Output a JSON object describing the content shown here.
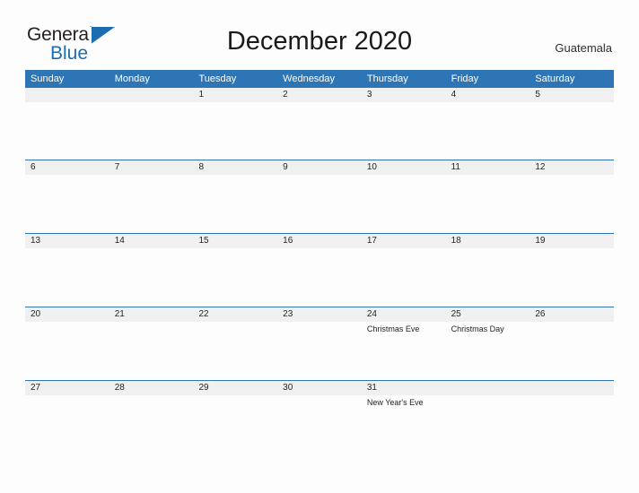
{
  "logo": {
    "primary_text": "General",
    "secondary_text": "Blue",
    "triangle_icon": "triangle-icon",
    "brand_color": "#1b6cb0"
  },
  "header": {
    "title": "December 2020",
    "country": "Guatemala"
  },
  "calendar": {
    "header_color": "#2e75b6",
    "date_band_color": "#f0f0f0",
    "weekdays": [
      "Sunday",
      "Monday",
      "Tuesday",
      "Wednesday",
      "Thursday",
      "Friday",
      "Saturday"
    ],
    "weeks": [
      {
        "days": [
          {
            "date": "",
            "event": ""
          },
          {
            "date": "",
            "event": ""
          },
          {
            "date": "1",
            "event": ""
          },
          {
            "date": "2",
            "event": ""
          },
          {
            "date": "3",
            "event": ""
          },
          {
            "date": "4",
            "event": ""
          },
          {
            "date": "5",
            "event": ""
          }
        ]
      },
      {
        "days": [
          {
            "date": "6",
            "event": ""
          },
          {
            "date": "7",
            "event": ""
          },
          {
            "date": "8",
            "event": ""
          },
          {
            "date": "9",
            "event": ""
          },
          {
            "date": "10",
            "event": ""
          },
          {
            "date": "11",
            "event": ""
          },
          {
            "date": "12",
            "event": ""
          }
        ]
      },
      {
        "days": [
          {
            "date": "13",
            "event": ""
          },
          {
            "date": "14",
            "event": ""
          },
          {
            "date": "15",
            "event": ""
          },
          {
            "date": "16",
            "event": ""
          },
          {
            "date": "17",
            "event": ""
          },
          {
            "date": "18",
            "event": ""
          },
          {
            "date": "19",
            "event": ""
          }
        ]
      },
      {
        "days": [
          {
            "date": "20",
            "event": ""
          },
          {
            "date": "21",
            "event": ""
          },
          {
            "date": "22",
            "event": ""
          },
          {
            "date": "23",
            "event": ""
          },
          {
            "date": "24",
            "event": "Christmas Eve"
          },
          {
            "date": "25",
            "event": "Christmas Day"
          },
          {
            "date": "26",
            "event": ""
          }
        ]
      },
      {
        "days": [
          {
            "date": "27",
            "event": ""
          },
          {
            "date": "28",
            "event": ""
          },
          {
            "date": "29",
            "event": ""
          },
          {
            "date": "30",
            "event": ""
          },
          {
            "date": "31",
            "event": "New Year's Eve"
          },
          {
            "date": "",
            "event": ""
          },
          {
            "date": "",
            "event": ""
          }
        ]
      }
    ]
  }
}
